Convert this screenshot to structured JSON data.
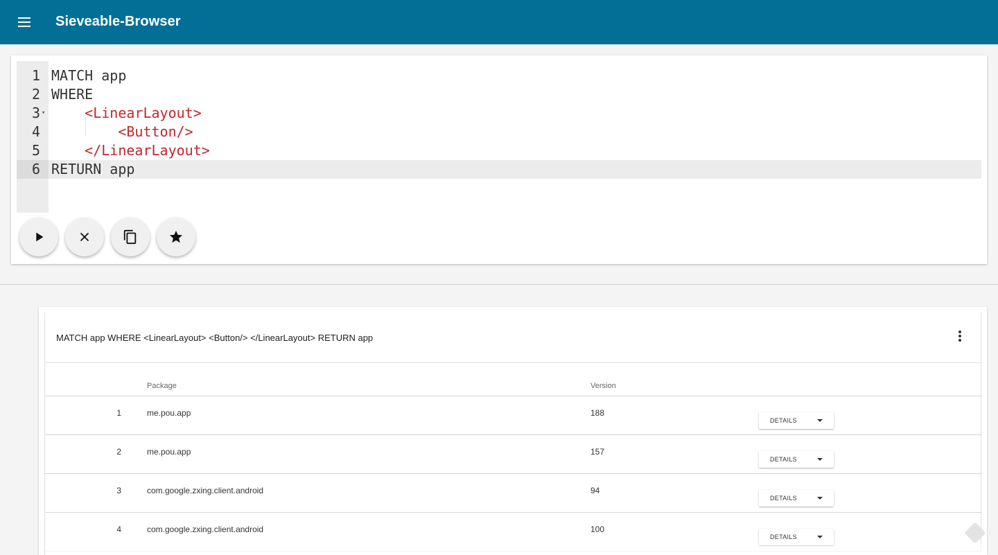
{
  "app": {
    "title": "Sieveable-Browser",
    "menu_icon": "hamburger-menu-icon",
    "brand_color": "#036f96"
  },
  "editor": {
    "lines": [
      {
        "number": "1",
        "code": "MATCH app",
        "kind": "keyword"
      },
      {
        "number": "2",
        "code": "WHERE",
        "kind": "keyword"
      },
      {
        "number": "3",
        "code": "    <LinearLayout>",
        "kind": "tag"
      },
      {
        "number": "4",
        "code": "        <Button/>",
        "kind": "tag"
      },
      {
        "number": "5",
        "code": "    </LinearLayout>",
        "kind": "tag"
      },
      {
        "number": "6",
        "code": "RETURN app",
        "kind": "keyword"
      }
    ],
    "active_line": 6,
    "tag_color": "#c0272d",
    "actions": [
      {
        "name": "run-query-button",
        "icon": "play-icon"
      },
      {
        "name": "clear-query-button",
        "icon": "close-icon"
      },
      {
        "name": "copy-query-button",
        "icon": "copy-icon"
      },
      {
        "name": "favorite-query-button",
        "icon": "star-icon"
      }
    ]
  },
  "results": {
    "query": "MATCH app WHERE <LinearLayout> <Button/> </LinearLayout> RETURN app",
    "more_icon": "more-vert-icon",
    "columns": {
      "package": "Package",
      "version": "Version"
    },
    "rows": [
      {
        "index": "1",
        "package": "me.pou.app",
        "version": "188",
        "action": "DETAILS"
      },
      {
        "index": "2",
        "package": "me.pou.app",
        "version": "157",
        "action": "DETAILS"
      },
      {
        "index": "3",
        "package": "com.google.zxing.client.android",
        "version": "94",
        "action": "DETAILS"
      },
      {
        "index": "4",
        "package": "com.google.zxing.client.android",
        "version": "100",
        "action": "DETAILS"
      }
    ]
  }
}
